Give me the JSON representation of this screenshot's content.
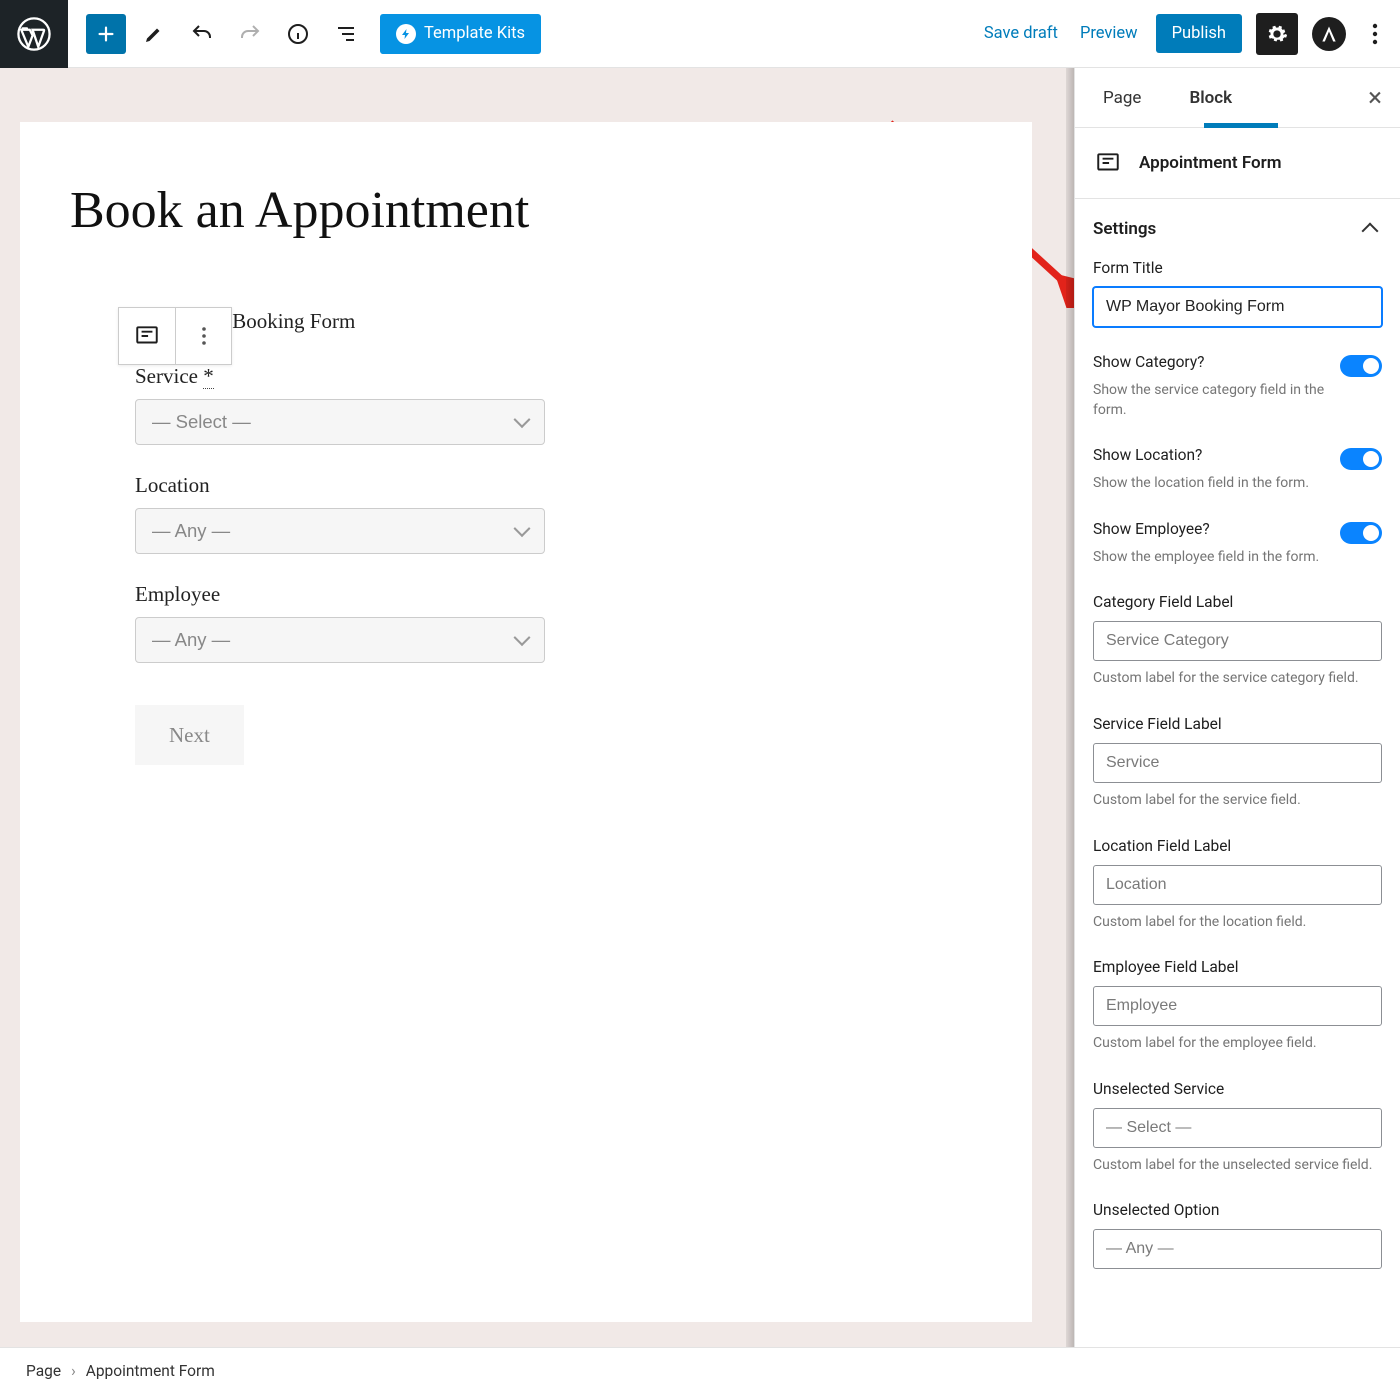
{
  "topbar": {
    "template_kits": "Template Kits",
    "save_draft": "Save draft",
    "preview": "Preview",
    "publish": "Publish"
  },
  "canvas": {
    "page_title": "Book an Appointment",
    "form_title": "WP Mayor Booking Form",
    "fields": {
      "service_label": "Service",
      "service_required_mark": "*",
      "service_value": "— Select —",
      "location_label": "Location",
      "location_value": "— Any —",
      "employee_label": "Employee",
      "employee_value": "— Any —"
    },
    "next": "Next"
  },
  "sidebar": {
    "tabs": {
      "page": "Page",
      "block": "Block"
    },
    "block_name": "Appointment Form",
    "panel_title": "Settings",
    "form_title": {
      "label": "Form Title",
      "value": "WP Mayor Booking Form"
    },
    "toggles": {
      "category": {
        "label": "Show Category?",
        "help": "Show the service category field in the form."
      },
      "location": {
        "label": "Show Location?",
        "help": "Show the location field in the form."
      },
      "employee": {
        "label": "Show Employee?",
        "help": "Show the employee field in the form."
      }
    },
    "category_label": {
      "label": "Category Field Label",
      "value": "Service Category",
      "help": "Custom label for the service category field."
    },
    "service_label": {
      "label": "Service Field Label",
      "value": "Service",
      "help": "Custom label for the service field."
    },
    "location_label": {
      "label": "Location Field Label",
      "value": "Location",
      "help": "Custom label for the location field."
    },
    "employee_label": {
      "label": "Employee Field Label",
      "value": "Employee",
      "help": "Custom label for the employee field."
    },
    "unselected_service": {
      "label": "Unselected Service",
      "value": "— Select —",
      "help": "Custom label for the unselected service field."
    },
    "unselected_option": {
      "label": "Unselected Option",
      "value": "— Any —"
    }
  },
  "footer": {
    "crumb_root": "Page",
    "crumb_leaf": "Appointment Form"
  }
}
